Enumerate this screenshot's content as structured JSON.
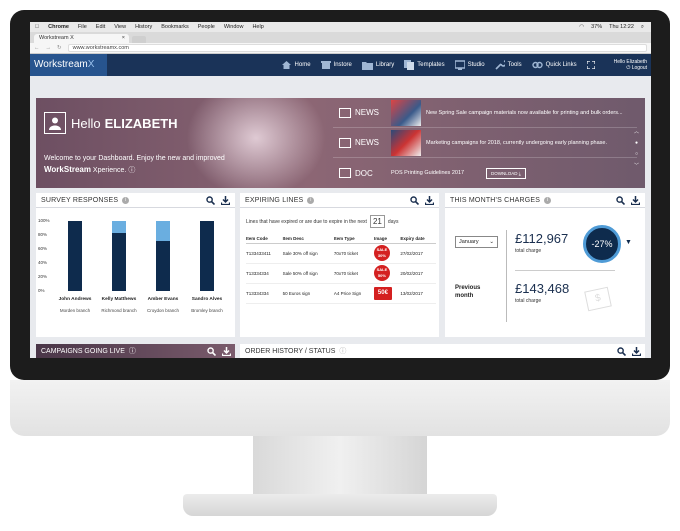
{
  "os_menu": {
    "apple": "",
    "app": "Chrome",
    "items": [
      "File",
      "Edit",
      "View",
      "History",
      "Bookmarks",
      "People",
      "Window",
      "Help"
    ],
    "battery": "37%",
    "clock": "Thu 12:22"
  },
  "browser": {
    "tab_title": "Workstream X",
    "url": "www.workstreamx.com"
  },
  "app": {
    "logo": "Workstream",
    "logo_suffix": "X",
    "nav": [
      "Home",
      "Instore",
      "Library",
      "Templates",
      "Studio",
      "Tools",
      "Quick Links"
    ],
    "user_greeting": "Hello Elizabeth",
    "logout": "Logout"
  },
  "hero": {
    "hello": "Hello",
    "name": "ELIZABETH",
    "welcome_line1": "Welcome to your Dashboard. Enjoy the new and improved",
    "welcome_brand": "WorkStream",
    "welcome_line2": " Xperience.",
    "news": [
      {
        "tag": "NEWS",
        "text": "New Spring Sale campaign materials now available for printing and bulk orders..."
      },
      {
        "tag": "NEWS",
        "text": "Marketing campaigns for 2018, currently undergoing early planning phase."
      },
      {
        "tag": "DOC",
        "text": "POS Printing Guidelines 2017",
        "button": "DOWNLOAD"
      }
    ]
  },
  "survey": {
    "title": "SURVEY RESPONSES",
    "axis": [
      "100%",
      "80%",
      "60%",
      "40%",
      "20%",
      "0%"
    ],
    "people": [
      {
        "name": "John Andrews",
        "branch": "Morden branch",
        "dark": 100,
        "light": 0
      },
      {
        "name": "Kelly Matthews",
        "branch": "Richmond branch",
        "dark": 83,
        "light": 17
      },
      {
        "name": "Amber Evans",
        "branch": "Croydon branch",
        "dark": 72,
        "light": 28
      },
      {
        "name": "Sandro Alves",
        "branch": "Bromley branch",
        "dark": 100,
        "light": 0
      }
    ]
  },
  "expiring": {
    "title": "EXPIRING LINES",
    "sub_pre": "Lines that have expired or are due to expire in the next",
    "days": "21",
    "sub_post": "days",
    "headers": [
      "Item Code",
      "Item Desc",
      "Item Type",
      "Image",
      "Expiry date"
    ],
    "rows": [
      {
        "code": "T133433411",
        "desc": "Sale 30% off sign",
        "type": "70x70 ticket",
        "img": "SALE 30%",
        "date": "27/02/2017"
      },
      {
        "code": "T13334334",
        "desc": "Sale 50% off sign",
        "type": "70x70 ticket",
        "img": "SALE 50%",
        "date": "20/02/2017"
      },
      {
        "code": "T13334334",
        "desc": "50 Euros sign",
        "type": "A4 Price Sign",
        "img": "50€",
        "date": "13/02/2017"
      }
    ]
  },
  "charges": {
    "title": "THIS MONTH'S CHARGES",
    "month": "January",
    "current": "£112,967",
    "current_label": "total charge",
    "change": "-27%",
    "previous_label_1": "Previous",
    "previous_label_2": "month",
    "previous": "£143,468",
    "previous_sub": "total charge"
  },
  "campaigns": {
    "title": "CAMPAIGNS GOING LIVE"
  },
  "orders": {
    "title": "ORDER HISTORY / STATUS"
  }
}
